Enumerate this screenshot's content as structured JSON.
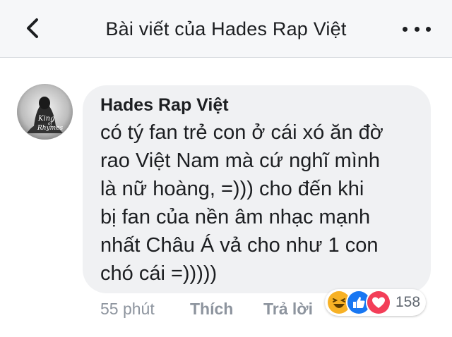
{
  "header": {
    "title": "Bài viết của Hades Rap Việt",
    "back_icon": "chevron-left-icon",
    "more_icon": "more-horizontal-icon"
  },
  "comment": {
    "author": "Hades Rap Việt",
    "lines": [
      "có tý fan trẻ con ở cái xó ăn đờ",
      "rao Việt Nam mà cứ nghĩ mình",
      "là nữ hoàng, =))) cho đến khi",
      "bị fan của nền âm nhạc mạnh",
      "nhất Châu Á vả cho như 1 con",
      "chó cái =)))))"
    ],
    "avatar_text": [
      "King",
      "of",
      "Rhymes"
    ],
    "time": "55 phút",
    "like_label": "Thích",
    "reply_label": "Trả lời",
    "reactions": {
      "icons": [
        "haha-icon",
        "like-icon",
        "love-icon"
      ],
      "count": "158"
    }
  },
  "colors": {
    "bubble": "#f0f1f3",
    "meta_text": "#8d949e",
    "like_blue": "#1877f2",
    "love_red": "#f33e58",
    "haha_yellow": "#f7b125"
  }
}
